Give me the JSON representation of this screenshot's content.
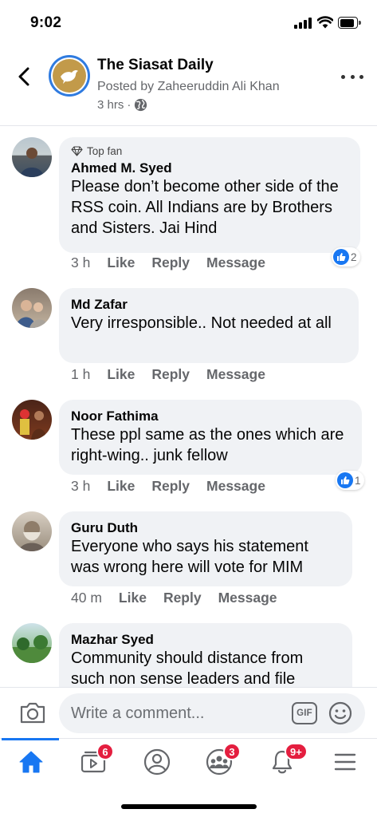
{
  "status_bar": {
    "time": "9:02"
  },
  "header": {
    "page_name": "The Siasat Daily",
    "posted_by": "Posted by Zaheeruddin Ali Khan",
    "post_age": "3 hrs",
    "post_separator": "·"
  },
  "actions": {
    "like": "Like",
    "reply": "Reply",
    "message": "Message"
  },
  "comments": [
    {
      "badge": "Top fan",
      "name": "Ahmed M. Syed",
      "text": "Please don’t become other side of the RSS coin. All Indians are by Brothers and Sisters. Jai Hind",
      "age": "3 h",
      "reactions": "2"
    },
    {
      "name": "Md Zafar",
      "text": "Very irresponsible.. Not needed at all",
      "age": "1 h"
    },
    {
      "name": "Noor Fathima",
      "text": "These ppl same as the ones which are right-wing.. junk fellow",
      "age": "3 h",
      "reactions": "1"
    },
    {
      "name": "Guru Duth",
      "text": "Everyone who says his statement was wrong here will vote for MIM",
      "age": "40 m"
    },
    {
      "name": "Mazhar Syed",
      "text": "Community should distance from such non sense leaders and file"
    }
  ],
  "composer": {
    "placeholder": "Write a comment...",
    "gif_label": "GIF"
  },
  "tabbar": {
    "video_badge": "6",
    "groups_badge": "3",
    "notifications_badge": "9+",
    "accent_color": "#1877f2"
  },
  "icons": [
    "back-icon",
    "more-icon",
    "globe-icon",
    "diamond-icon",
    "like-icon",
    "camera-icon",
    "gif-icon",
    "emoji-icon",
    "home-icon",
    "video-icon",
    "profile-icon",
    "groups-icon",
    "bell-icon",
    "menu-icon"
  ]
}
